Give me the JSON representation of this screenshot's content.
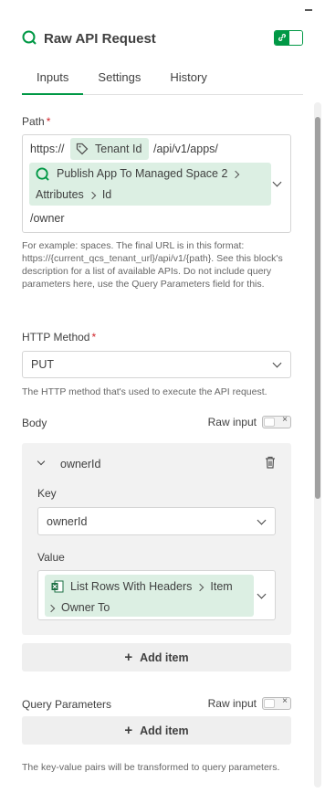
{
  "header": {
    "title": "Raw API Request",
    "icon": "search-icon"
  },
  "tabs": [
    {
      "label": "Inputs",
      "active": true
    },
    {
      "label": "Settings",
      "active": false
    },
    {
      "label": "History",
      "active": false
    }
  ],
  "path": {
    "label": "Path",
    "required_mark": "*",
    "segments": {
      "prefix": "https://",
      "tenant_chip": "Tenant Id",
      "middle": "/api/v1/apps/",
      "block_chip": "Publish App To Managed Space 2",
      "attr1": "Attributes",
      "attr2": "Id",
      "suffix": "/owner"
    },
    "help": "For example: spaces. The final URL is in this format: https://{current_qcs_tenant_url}/api/v1/{path}. See this block's description for a list of available APIs. Do not include query parameters here, use the Query Parameters field for this."
  },
  "http_method": {
    "label": "HTTP Method",
    "required_mark": "*",
    "value": "PUT",
    "help": "The HTTP method that's used to execute the API request."
  },
  "body": {
    "label": "Body",
    "raw_input_label": "Raw input",
    "item": {
      "name": "ownerId",
      "key_label": "Key",
      "key_value": "ownerId",
      "value_label": "Value",
      "value_chip_block": "List Rows With Headers",
      "value_chip_item": "Item",
      "value_chip_field": "Owner To"
    },
    "add_item_label": "Add item"
  },
  "query": {
    "label": "Query Parameters",
    "raw_input_label": "Raw input",
    "add_item_label": "Add item",
    "help": "The key-value pairs will be transformed to query parameters."
  },
  "colors": {
    "accent": "#009845",
    "chip": "#dcefe3",
    "required": "#d0242b"
  }
}
